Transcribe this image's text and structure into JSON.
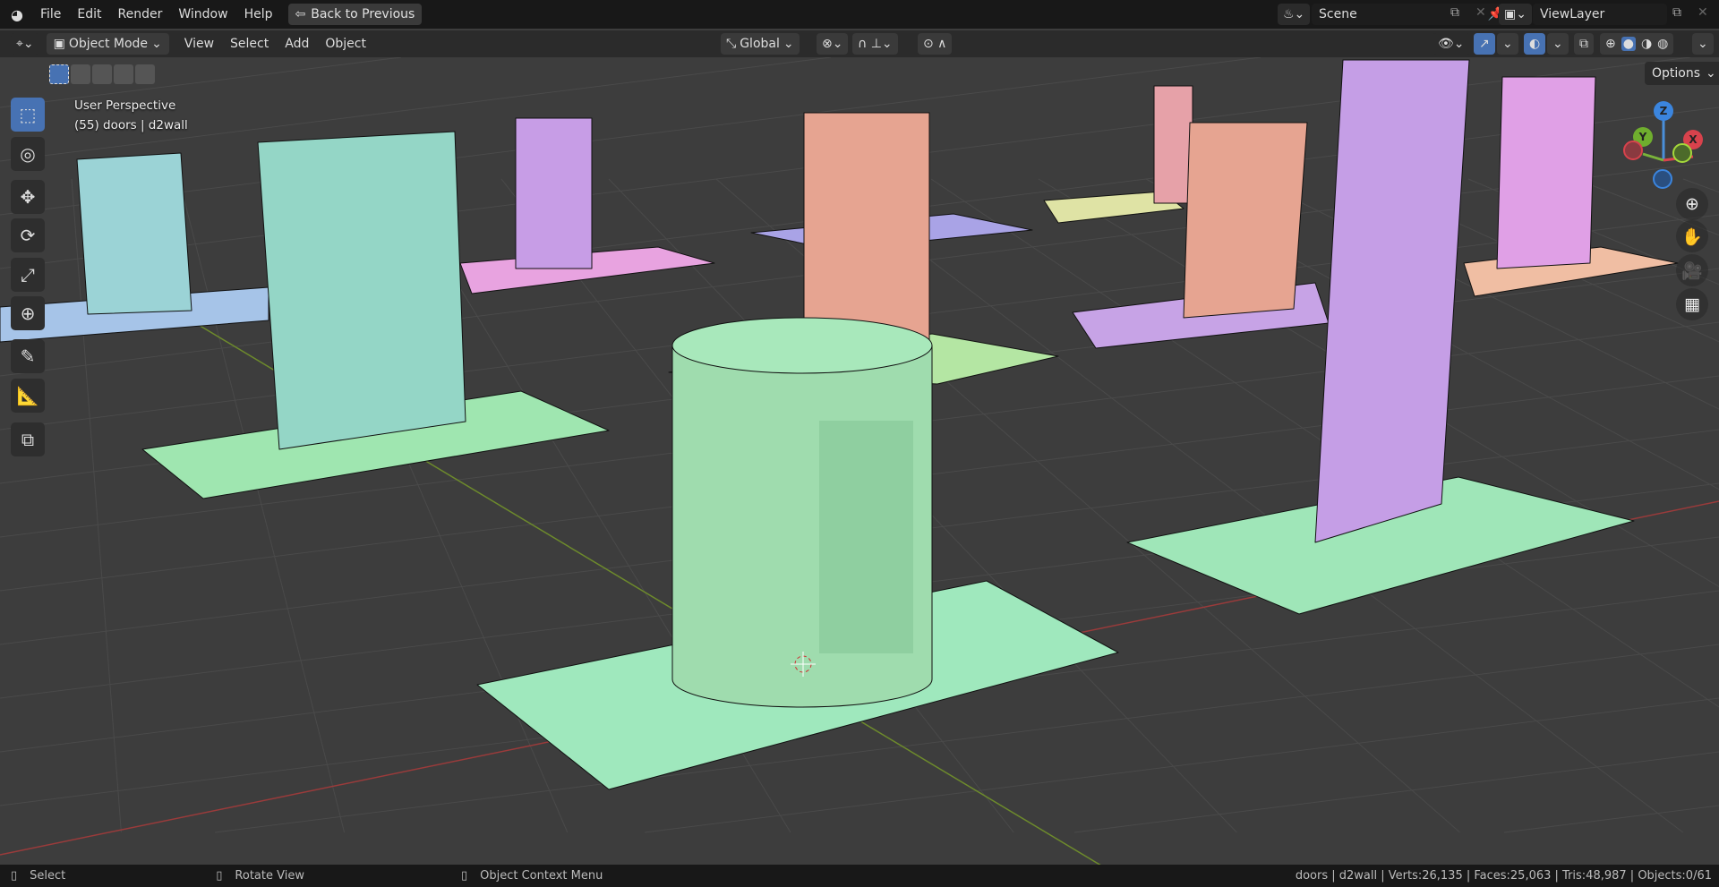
{
  "topbar": {
    "menus": [
      "File",
      "Edit",
      "Render",
      "Window",
      "Help"
    ],
    "back_button": "Back to Previous",
    "scene": "Scene",
    "view_layer": "ViewLayer"
  },
  "header": {
    "mode": "Object Mode",
    "menus": [
      "View",
      "Select",
      "Add",
      "Object"
    ],
    "orientation": "Global"
  },
  "viewport": {
    "perspective": "User Perspective",
    "object_info": "(55) doors | d2wall",
    "options": "Options",
    "gizmo": {
      "x": "X",
      "y": "Y",
      "z": "Z"
    }
  },
  "status": {
    "hints": [
      "Select",
      "Rotate View",
      "Object Context Menu"
    ],
    "stats": "doors | d2wall | Verts:26,135 | Faces:25,063 | Tris:48,987 | Objects:0/61"
  },
  "colors": {
    "accent": "#4772b3",
    "teal": "#9bd3d0",
    "green": "#9fe6b8",
    "purple": "#c79de6",
    "orange": "#e6a491",
    "pink": "#e8a3e0",
    "blue": "#a6c4e8"
  }
}
